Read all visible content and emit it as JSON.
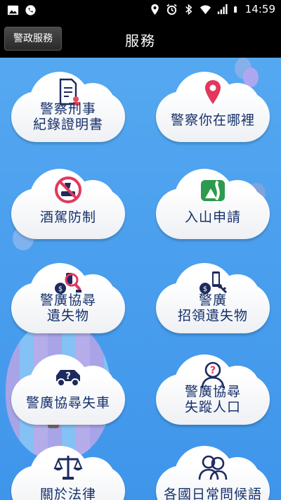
{
  "status_bar": {
    "time": "14:59"
  },
  "header": {
    "back_label": "警政服務",
    "title": "服務"
  },
  "tiles": [
    {
      "lines": [
        "警察刑事",
        "紀錄證明書"
      ],
      "icon": "document-stamp-icon"
    },
    {
      "lines": [
        "警察你在哪裡"
      ],
      "icon": "location-pin-icon"
    },
    {
      "lines": [
        "酒駕防制"
      ],
      "icon": "no-drunk-driving-icon"
    },
    {
      "lines": [
        "入山申請"
      ],
      "icon": "mountain-road-icon"
    },
    {
      "lines": [
        "警廣協尋",
        "遺失物"
      ],
      "icon": "lost-items-search-icon"
    },
    {
      "lines": [
        "警廣",
        "招領遺失物"
      ],
      "icon": "lost-items-claim-icon"
    },
    {
      "lines": [
        "警廣協尋失車"
      ],
      "icon": "car-question-icon"
    },
    {
      "lines": [
        "警廣協尋",
        "失蹤人口"
      ],
      "icon": "person-question-icon"
    },
    {
      "lines": [
        "關於法律"
      ],
      "icon": "scales-icon"
    },
    {
      "lines": [
        "各國日常問候語"
      ],
      "icon": "people-chat-icon"
    }
  ]
}
